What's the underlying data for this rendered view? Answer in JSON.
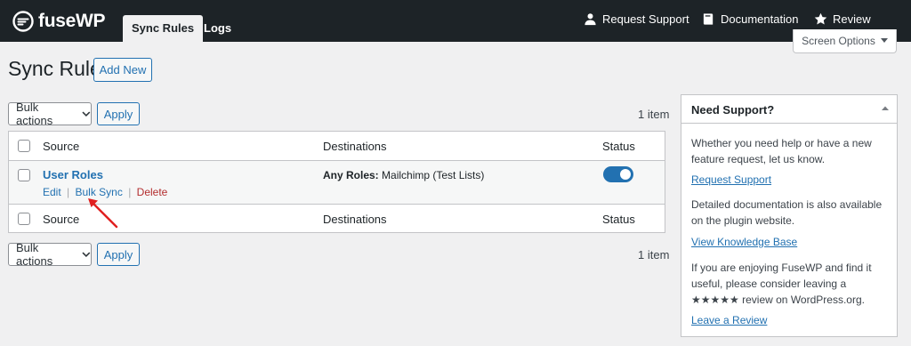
{
  "brand": {
    "name": "fuseWP"
  },
  "nav": {
    "tabs": [
      {
        "label": "Sync Rules",
        "active": true
      },
      {
        "label": "Logs",
        "active": false
      }
    ],
    "links": [
      {
        "label": "Request Support",
        "icon": "person-icon"
      },
      {
        "label": "Documentation",
        "icon": "book-icon"
      },
      {
        "label": "Review",
        "icon": "star-icon"
      }
    ]
  },
  "screen_options": {
    "label": "Screen Options"
  },
  "page": {
    "title": "Sync Rules",
    "add_new": "Add New"
  },
  "bulk": {
    "top": {
      "select": "Bulk actions",
      "apply": "Apply",
      "count": "1 item"
    },
    "bottom": {
      "select": "Bulk actions",
      "apply": "Apply",
      "count": "1 item"
    }
  },
  "table": {
    "columns": [
      "Source",
      "Destinations",
      "Status"
    ],
    "rows": [
      {
        "source": "User Roles",
        "actions": {
          "edit": "Edit",
          "bulk_sync": "Bulk Sync",
          "delete": "Delete",
          "separator": "|"
        },
        "destination_label": "Any Roles:",
        "destination_value": "Mailchimp (Test Lists)",
        "status_enabled": true
      }
    ]
  },
  "sidebar": {
    "title": "Need Support?",
    "text1": "Whether you need help or have a new feature request, let us know.",
    "link1": "Request Support",
    "text2": "Detailed documentation is also available on the plugin website.",
    "link2": "View Knowledge Base",
    "text3": "If you are enjoying FuseWP and find it useful, please consider leaving a ★★★★★ review on WordPress.org.",
    "link3": "Leave a Review"
  },
  "colors": {
    "accent": "#2271b1",
    "topbar": "#1d2327",
    "delete": "#b32d2e",
    "annotation": "#e02020"
  }
}
